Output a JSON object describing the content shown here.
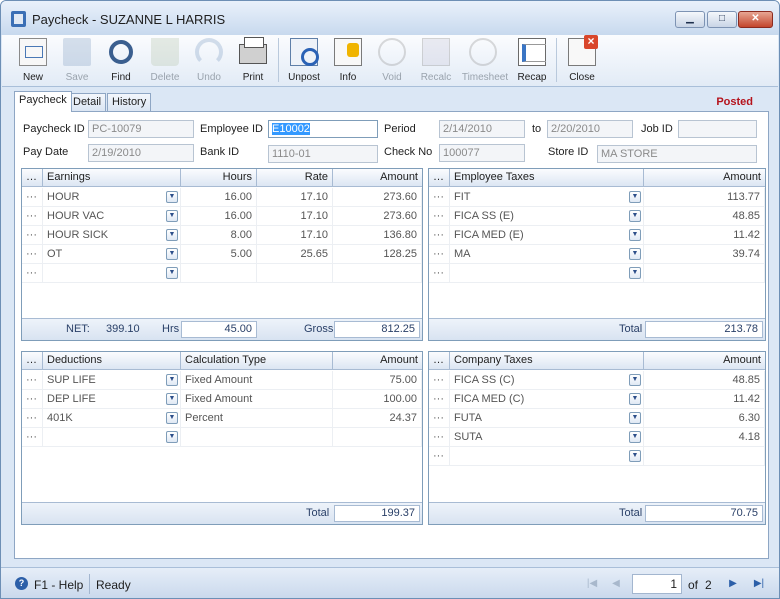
{
  "window": {
    "title": "Paycheck - SUZANNE L HARRIS"
  },
  "toolbar": {
    "new": "New",
    "save": "Save",
    "find": "Find",
    "delete": "Delete",
    "undo": "Undo",
    "print": "Print",
    "unpost": "Unpost",
    "info": "Info",
    "void": "Void",
    "recalc": "Recalc",
    "timesheet": "Timesheet",
    "recap": "Recap",
    "close": "Close"
  },
  "tabs": [
    "Paycheck",
    "Detail",
    "History"
  ],
  "status_badge": "Posted",
  "header": {
    "paycheck_id_label": "Paycheck ID",
    "paycheck_id": "PC-10079",
    "employee_id_label": "Employee ID",
    "employee_id": "E10002",
    "period_label": "Period",
    "period_from": "2/14/2010",
    "to_label": "to",
    "period_to": "2/20/2010",
    "job_id_label": "Job ID",
    "job_id": "",
    "pay_date_label": "Pay Date",
    "pay_date": "2/19/2010",
    "bank_id_label": "Bank ID",
    "bank_id": "1110-01",
    "check_no_label": "Check No",
    "check_no": "100077",
    "store_id_label": "Store ID",
    "store_id": "MA STORE"
  },
  "earnings": {
    "columns": [
      "Earnings",
      "Hours",
      "Rate",
      "Amount"
    ],
    "rows": [
      {
        "name": "HOUR",
        "hours": "16.00",
        "rate": "17.10",
        "amount": "273.60"
      },
      {
        "name": "HOUR VAC",
        "hours": "16.00",
        "rate": "17.10",
        "amount": "273.60"
      },
      {
        "name": "HOUR SICK",
        "hours": "8.00",
        "rate": "17.10",
        "amount": "136.80"
      },
      {
        "name": "OT",
        "hours": "5.00",
        "rate": "25.65",
        "amount": "128.25"
      },
      {
        "name": "",
        "hours": "",
        "rate": "",
        "amount": ""
      }
    ],
    "net_label": "NET:",
    "net": "399.10",
    "hrs_label": "Hrs",
    "hrs": "45.00",
    "gross_label": "Gross",
    "gross": "812.25"
  },
  "employee_taxes": {
    "columns": [
      "Employee Taxes",
      "Amount"
    ],
    "rows": [
      {
        "name": "FIT",
        "amount": "113.77"
      },
      {
        "name": "FICA SS (E)",
        "amount": "48.85"
      },
      {
        "name": "FICA MED (E)",
        "amount": "11.42"
      },
      {
        "name": "MA",
        "amount": "39.74"
      },
      {
        "name": "",
        "amount": ""
      }
    ],
    "total_label": "Total",
    "total": "213.78"
  },
  "deductions": {
    "columns": [
      "Deductions",
      "Calculation Type",
      "Amount"
    ],
    "rows": [
      {
        "name": "SUP LIFE",
        "type": "Fixed Amount",
        "amount": "75.00"
      },
      {
        "name": "DEP LIFE",
        "type": "Fixed Amount",
        "amount": "100.00"
      },
      {
        "name": "401K",
        "type": "Percent",
        "amount": "24.37"
      },
      {
        "name": "",
        "type": "",
        "amount": ""
      }
    ],
    "total_label": "Total",
    "total": "199.37"
  },
  "company_taxes": {
    "columns": [
      "Company Taxes",
      "Amount"
    ],
    "rows": [
      {
        "name": "FICA SS (C)",
        "amount": "48.85"
      },
      {
        "name": "FICA MED (C)",
        "amount": "11.42"
      },
      {
        "name": "FUTA",
        "amount": "6.30"
      },
      {
        "name": "SUTA",
        "amount": "4.18"
      },
      {
        "name": "",
        "amount": ""
      }
    ],
    "total_label": "Total",
    "total": "70.75"
  },
  "statusbar": {
    "help": "F1 - Help",
    "status": "Ready",
    "page": "1",
    "of_label": "of",
    "page_count": "2"
  },
  "icons": {
    "dropdown": "chevron-down-icon",
    "row_marker": "ellipsis-icon"
  }
}
